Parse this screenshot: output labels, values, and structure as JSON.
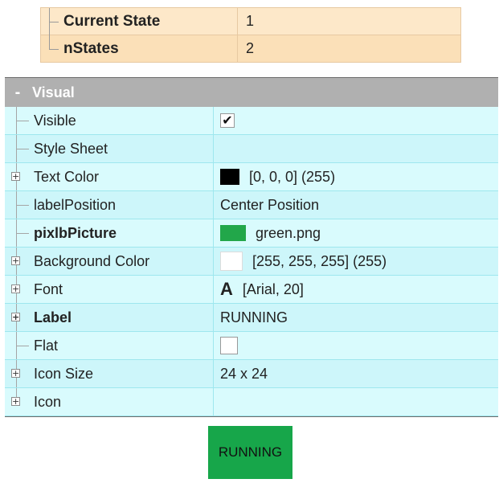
{
  "top_table": {
    "rows": [
      {
        "name": "Current State",
        "value": "1"
      },
      {
        "name": "nStates",
        "value": "2"
      }
    ]
  },
  "visual_group": {
    "collapse_symbol": "-",
    "title": "Visual",
    "properties": [
      {
        "name": "Visible",
        "value": "",
        "checked": true
      },
      {
        "name": "Style Sheet",
        "value": ""
      },
      {
        "name": "Text Color",
        "value": "[0, 0, 0] (255)",
        "swatch_color": "#000000"
      },
      {
        "name": "labelPosition",
        "value": "Center Position"
      },
      {
        "name": "pixlbPicture",
        "value": "green.png",
        "swatch_color": "#22a74a"
      },
      {
        "name": "Background Color",
        "value": "[255, 255, 255] (255)",
        "swatch_color": "#ffffff"
      },
      {
        "name": "Font",
        "value": "[Arial, 20]",
        "icon_glyph": "A"
      },
      {
        "name": "Label",
        "value": "RUNNING"
      },
      {
        "name": "Flat",
        "value": "",
        "checked": false
      },
      {
        "name": "Icon Size",
        "value": "24 x 24"
      },
      {
        "name": "Icon",
        "value": ""
      }
    ]
  },
  "preview_button": {
    "label": "RUNNING",
    "color": "#17a64a"
  }
}
